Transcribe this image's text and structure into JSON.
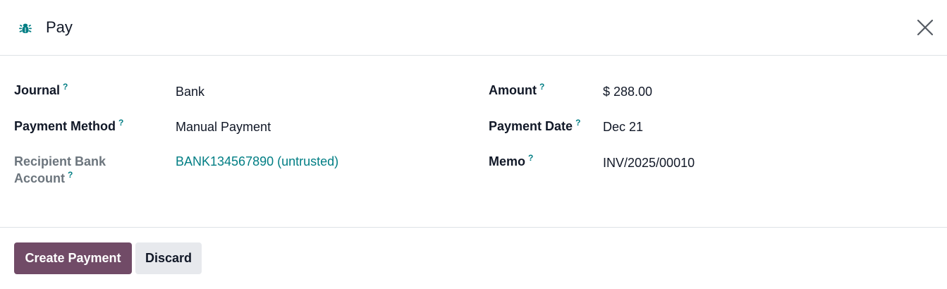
{
  "header": {
    "title": "Pay",
    "icon": "bug-icon",
    "close_icon": "close-icon"
  },
  "colors": {
    "accent": "#017e84",
    "primary_button": "#714b67",
    "secondary_button": "#e7e9ed"
  },
  "form": {
    "help_marker": "?",
    "journal": {
      "label": "Journal",
      "value": "Bank"
    },
    "payment_method": {
      "label": "Payment Method",
      "value": "Manual Payment"
    },
    "recipient_bank_account": {
      "label_line1": "Recipient Bank",
      "label_line2": "Account",
      "value": "BANK134567890 (untrusted)"
    },
    "amount": {
      "label": "Amount",
      "value": "$ 288.00"
    },
    "payment_date": {
      "label": "Payment Date",
      "value": "Dec 21"
    },
    "memo": {
      "label": "Memo",
      "value": "INV/2025/00010"
    }
  },
  "footer": {
    "create_payment_label": "Create Payment",
    "discard_label": "Discard"
  }
}
